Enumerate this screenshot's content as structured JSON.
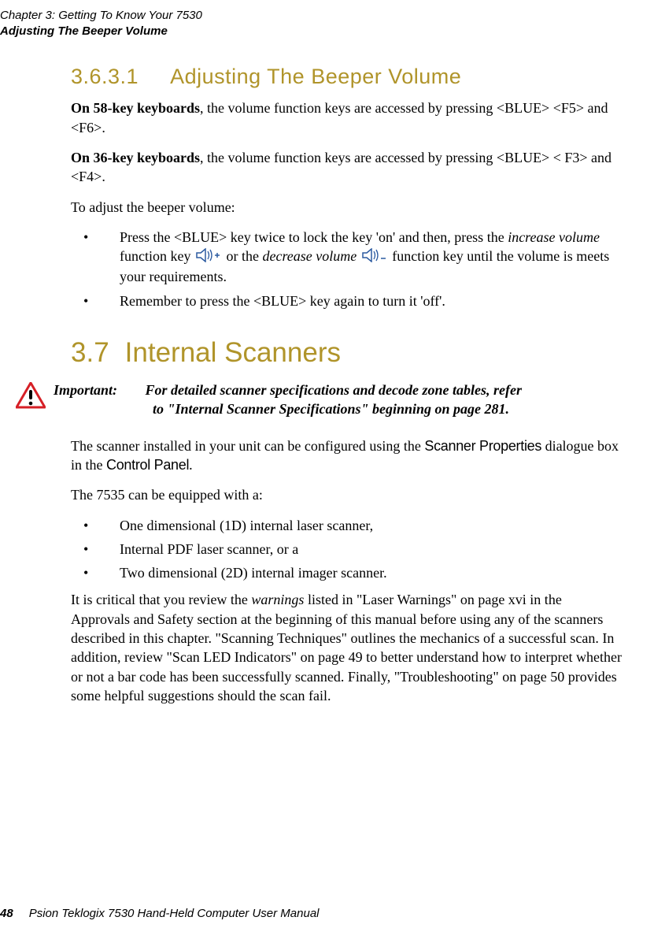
{
  "header": {
    "line1": "Chapter 3: Getting To Know Your 7530",
    "line2": "Adjusting The Beeper Volume"
  },
  "section3631": {
    "number": "3.6.3.1",
    "title": "Adjusting The Beeper Volume",
    "p1_bold": "On 58-key keyboards",
    "p1_rest": ", the volume function keys are accessed by pressing <BLUE> <F5> and <F6>.",
    "p2_bold": "On 36-key keyboards",
    "p2_rest": ", the volume function keys are accessed by pressing <BLUE> < F3> and <F4>.",
    "p3": "To adjust the beeper volume:",
    "b1_pre": "Press the <BLUE> key twice to lock the key 'on' and then, press the ",
    "b1_it1": "increase volume",
    "b1_mid": " function key ",
    "b1_or": " or the ",
    "b1_it2": "decrease volume",
    "b1_post": " function key until the volume is meets your requirements.",
    "b2": "Remember to press the <BLUE> key again to turn it 'off'."
  },
  "section37": {
    "number": "3.7",
    "title": "Internal Scanners",
    "important_label": "Important:",
    "important_text1": "For detailed scanner specifications and decode zone tables, refer",
    "important_text2": "to \"Internal Scanner Specifications\" beginning on page 281.",
    "p1_a": "The scanner installed in your unit can be configured using the ",
    "p1_sp": "Scanner Properties",
    "p1_b": " dialogue box in the ",
    "p1_cp": "Control Panel",
    "p1_c": ".",
    "p2": "The 7535 can be equipped with a:",
    "l1": "One dimensional (1D) internal laser scanner,",
    "l2": "Internal PDF laser scanner, or a",
    "l3": "Two dimensional (2D) internal imager scanner.",
    "p3a": "It is critical that you review the ",
    "p3it": "warnings",
    "p3b": " listed in \"Laser Warnings\" on page xvi in the Approvals and Safety section at the beginning of this manual before using any of the scanners described in this chapter. \"Scanning Techniques\" outlines the mechanics of a successful scan. In addition, review \"Scan LED Indicators\" on page 49 to better understand how to interpret whether or not a bar code has been successfully scanned. Finally, \"Troubleshooting\" on page 50 provides some helpful suggestions should the scan fail."
  },
  "footer": {
    "page": "48",
    "text": "Psion Teklogix 7530 Hand-Held Computer User Manual"
  }
}
